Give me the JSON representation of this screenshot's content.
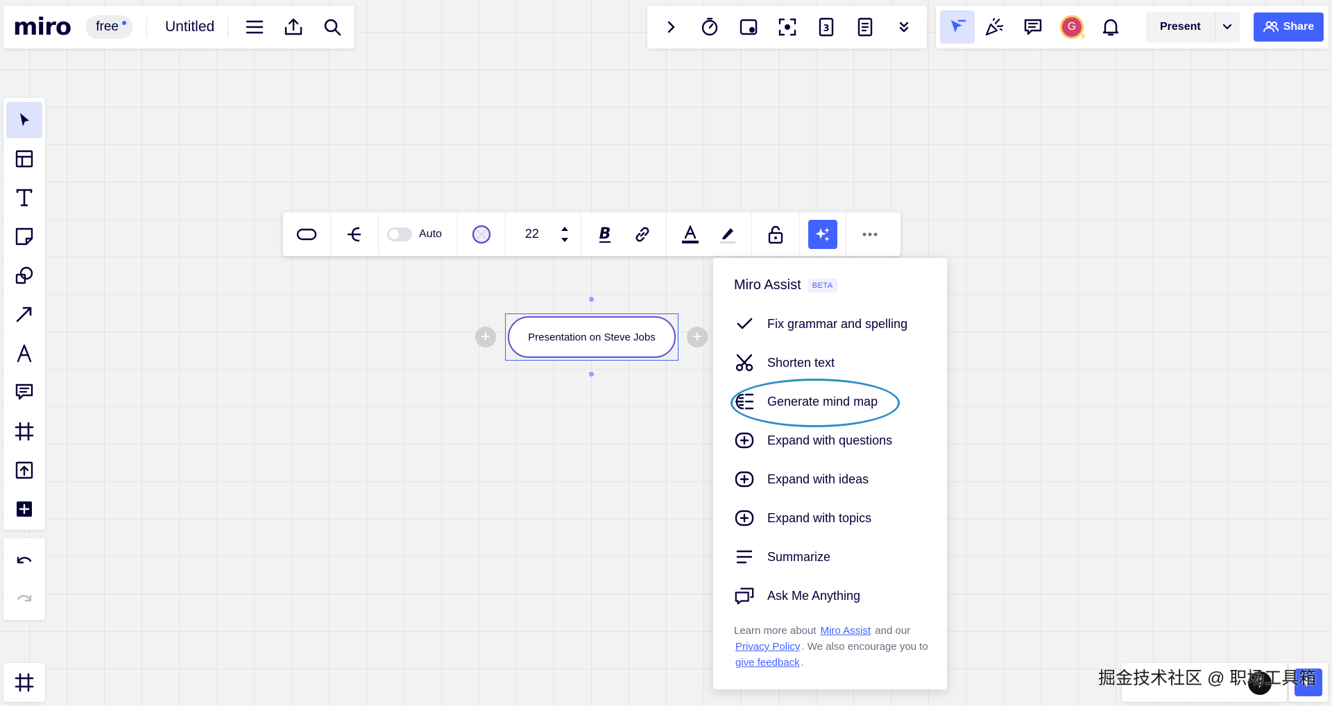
{
  "app": {
    "logo": "miro",
    "plan_badge": "free",
    "board_title": "Untitled"
  },
  "header": {
    "present_label": "Present",
    "share_label": "Share",
    "avatar_initial": "G"
  },
  "context_toolbar": {
    "auto_label": "Auto",
    "font_size": "22"
  },
  "canvas": {
    "node_text": "Presentation on Steve Jobs"
  },
  "assist_menu": {
    "title": "Miro Assist",
    "badge": "BETA",
    "items": [
      {
        "label": "Fix grammar and spelling",
        "icon": "check-icon"
      },
      {
        "label": "Shorten text",
        "icon": "scissors-icon"
      },
      {
        "label": "Generate mind map",
        "icon": "mind-map-icon"
      },
      {
        "label": "Expand with questions",
        "icon": "plus-box-icon"
      },
      {
        "label": "Expand with ideas",
        "icon": "plus-box-icon"
      },
      {
        "label": "Expand with topics",
        "icon": "plus-box-icon"
      },
      {
        "label": "Summarize",
        "icon": "lines-icon"
      },
      {
        "label": "Ask Me Anything",
        "icon": "chat-bubbles-icon"
      }
    ],
    "footer": {
      "t1": "Learn more about",
      "link1": "Miro Assist",
      "t2": "and our",
      "link2": "Privacy Policy",
      "t3": ". We also encourage you to",
      "link3": "give feedback",
      "t4": "."
    }
  },
  "watermark": "掘金技术社区 @ 职场工具箱",
  "colors": {
    "accent": "#4262ff",
    "highlight_ellipse": "#2f8dc9",
    "node_border": "#6b4ad1"
  }
}
